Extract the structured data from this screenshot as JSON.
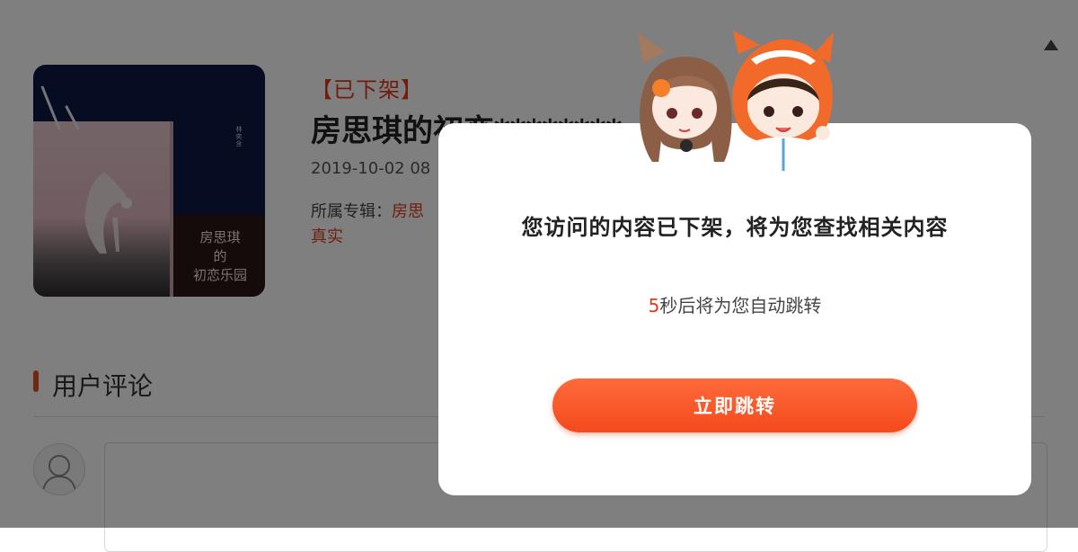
{
  "article": {
    "status_tag": "【已下架】",
    "title": "房思琪的初恋********",
    "date": "2019-10-02 08",
    "album_label": "所属专辑：",
    "album_value": "房思",
    "tag": "真实",
    "cover": {
      "author": "林奕含",
      "title_lines": [
        "房思琪",
        "的",
        "初恋乐园"
      ]
    }
  },
  "comments": {
    "section_title": "用户评论"
  },
  "modal": {
    "message": "您访问的内容已下架，将为您查找相关内容",
    "countdown_number": "5",
    "countdown_text": "秒后将为您自动跳转",
    "jump_button_label": "立即跳转"
  },
  "colors": {
    "accent": "#e03a1c",
    "button": "#f44a1e",
    "overlay": "rgba(0,0,0,0.5)"
  }
}
